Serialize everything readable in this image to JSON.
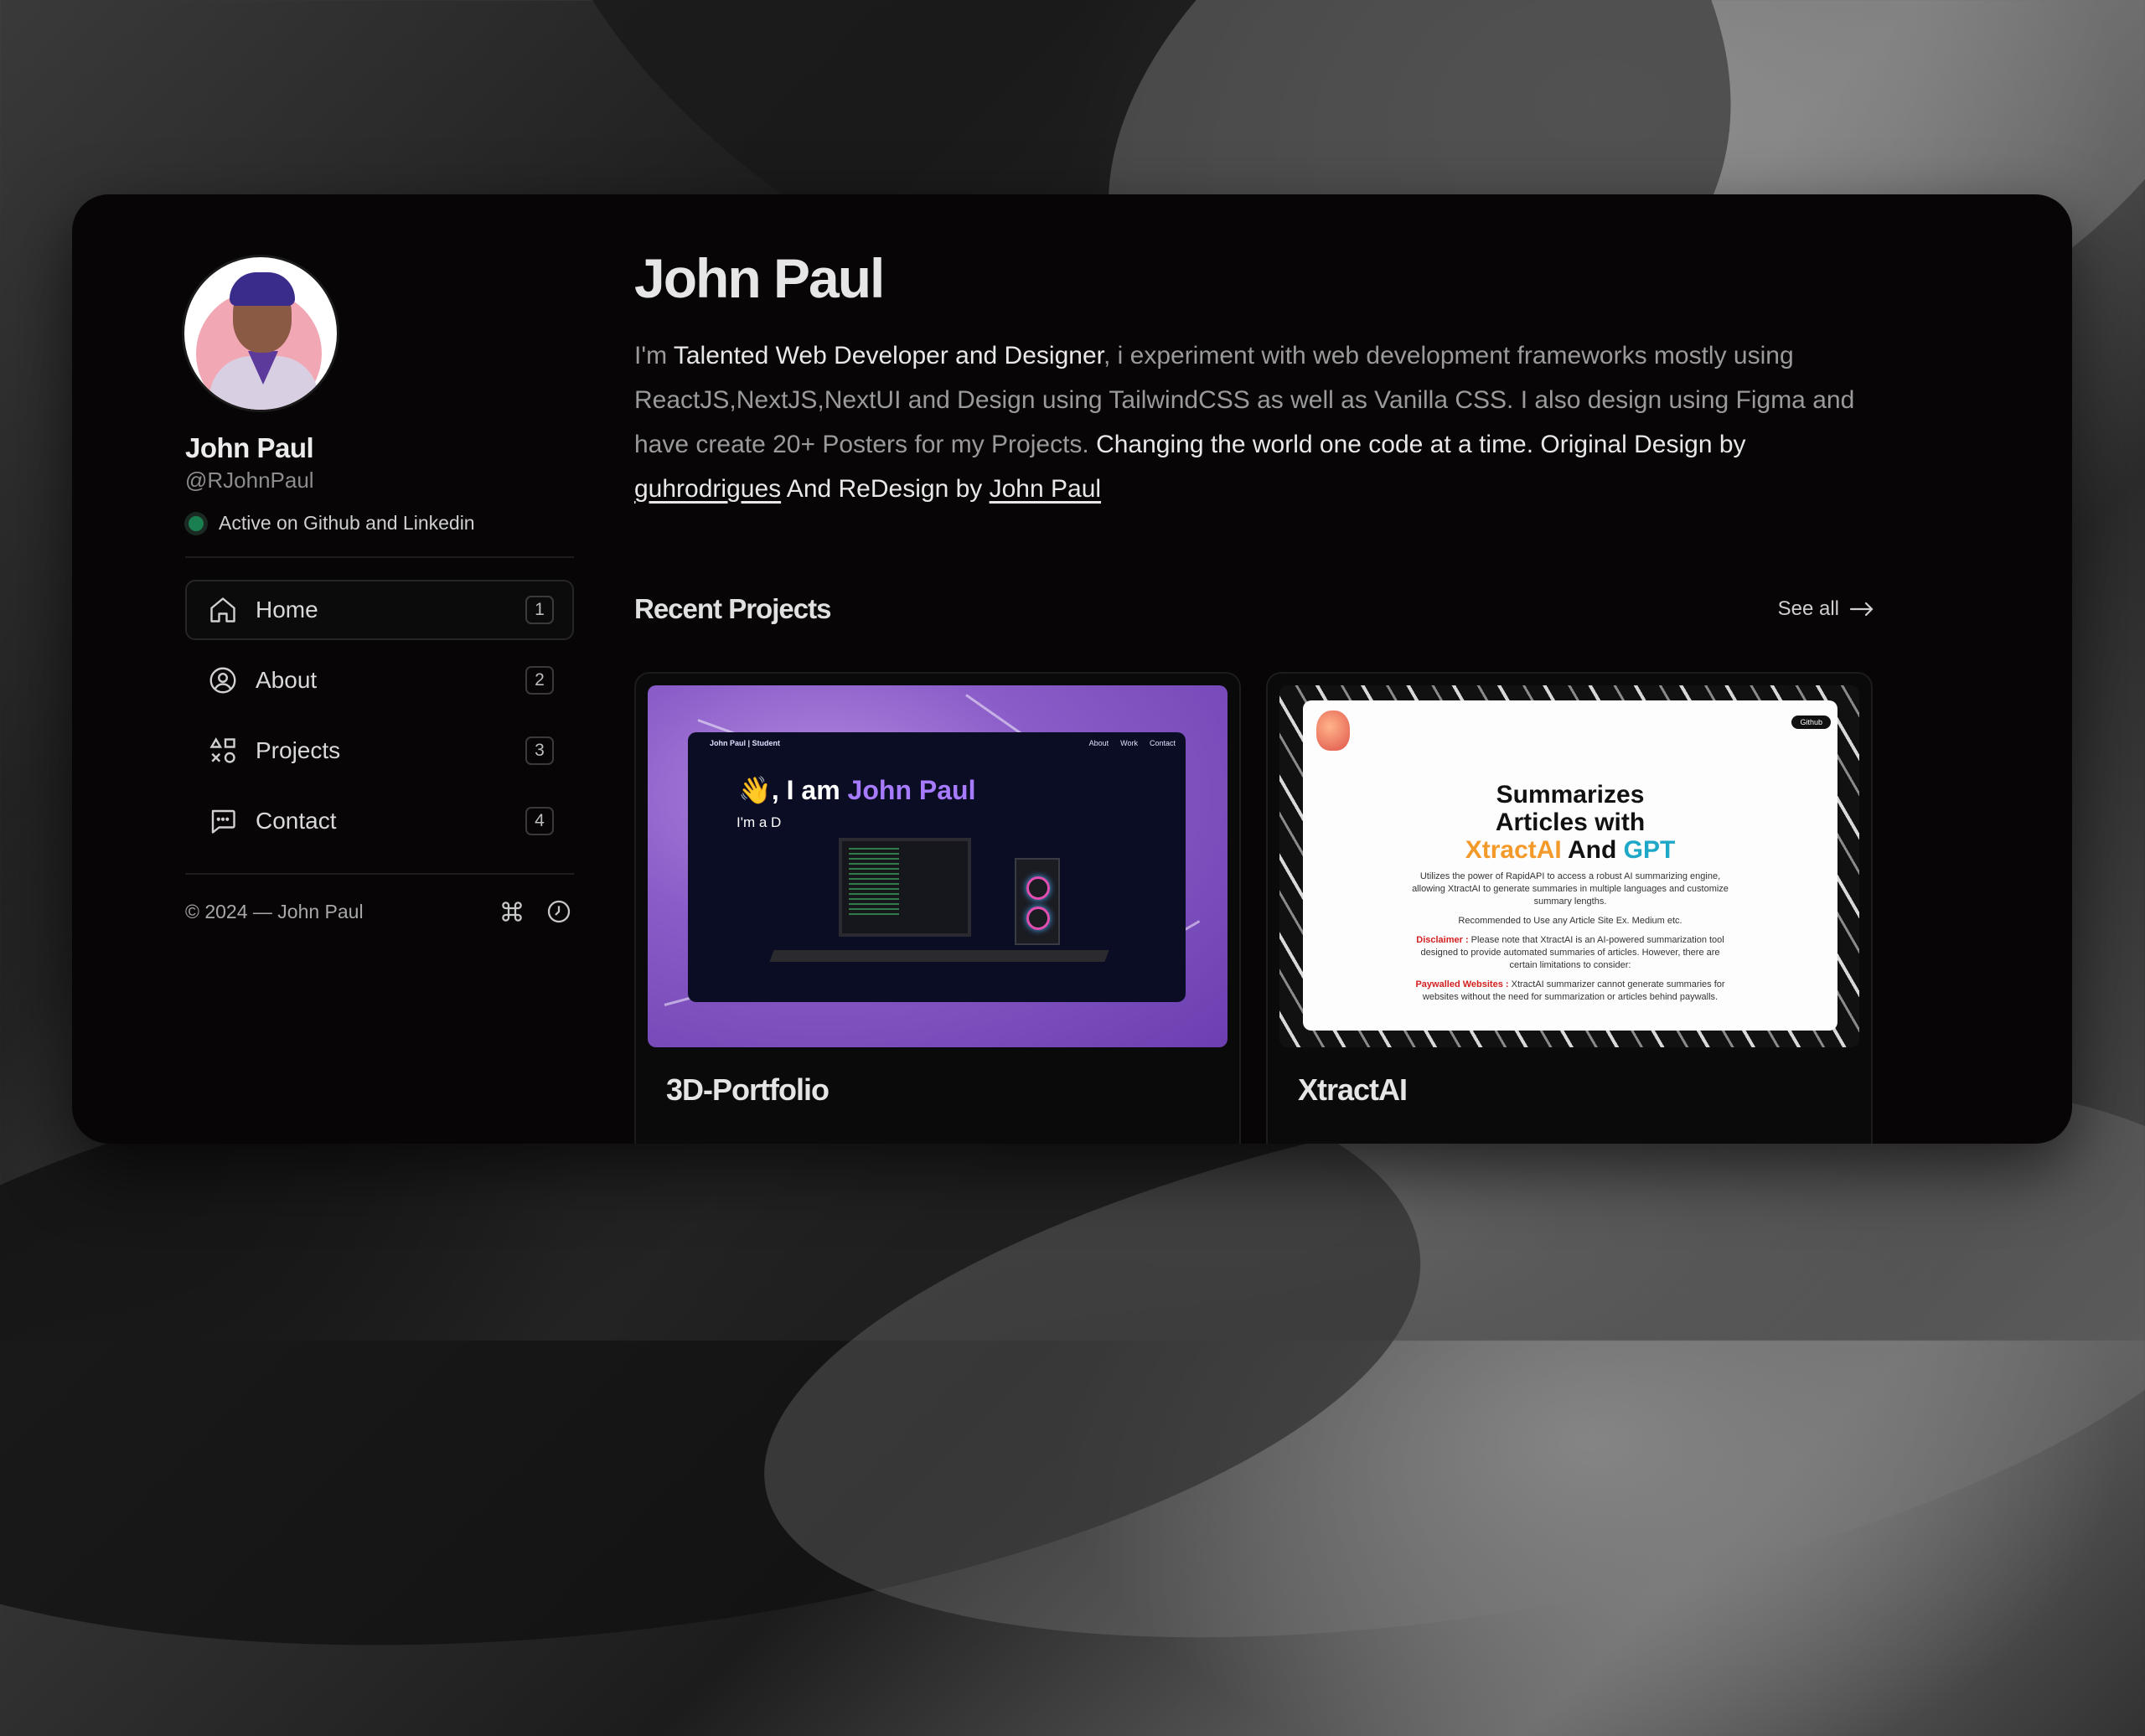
{
  "profile": {
    "name": "John Paul",
    "handle": "@RJohnPaul",
    "status": "Active on Github and Linkedin"
  },
  "nav": [
    {
      "label": "Home",
      "key": "1",
      "icon": "home-icon",
      "active": true
    },
    {
      "label": "About",
      "key": "2",
      "icon": "user-circle-icon",
      "active": false
    },
    {
      "label": "Projects",
      "key": "3",
      "icon": "shapes-icon",
      "active": false
    },
    {
      "label": "Contact",
      "key": "4",
      "icon": "chat-icon",
      "active": false
    }
  ],
  "footer": {
    "copyright": "© 2024 — John Paul",
    "icons": [
      "command-icon",
      "clock-icon"
    ]
  },
  "main": {
    "title": "John Paul",
    "bio": {
      "p1": "I'm ",
      "hl1": "Talented Web Developer and Designer",
      "p2": ", i experiment with web development frameworks mostly using ReactJS,NextJS,NextUI and Design using TailwindCSS as well as Vanilla CSS. I also design using Figma and have create 20+ Posters for my Projects. ",
      "hl2": "Changing the world one code at a time. Original Design by ",
      "link1": "guhrodrigues",
      "hl3": " And ReDesign by ",
      "link2": "John Paul"
    },
    "recent_title": "Recent Projects",
    "see_all": "See all"
  },
  "projects": [
    {
      "title": "3D-Portfolio",
      "thumb": {
        "nav_brand": "John Paul | Student",
        "nav_links": [
          "About",
          "Work",
          "Contact"
        ],
        "greeting_prefix": "👋, I am ",
        "greeting_name": "John Paul",
        "subtitle": "I'm a D"
      }
    },
    {
      "title": "XtractAI",
      "thumb": {
        "github_badge": "Github",
        "headline_1": "Summarizes",
        "headline_2": "Articles with",
        "headline_3a": "XtractAI",
        "headline_3b": " And ",
        "headline_3c": "GPT",
        "para_1": "Utilizes the power of RapidAPI to access a robust AI summarizing engine, allowing XtractAI to generate summaries in multiple languages and customize summary lengths.",
        "para_2": "Recommended to Use any Article Site Ex. Medium etc.",
        "disclaimer_label": "Disclaimer :",
        "disclaimer_text": " Please note that XtractAI is an AI-powered summarization tool designed to provide automated summaries of articles. However, there are certain limitations to consider:",
        "paywall_label": "Paywalled Websites :",
        "paywall_text": " XtractAI summarizer cannot generate summaries for websites without the need for summarization or articles behind paywalls."
      }
    }
  ],
  "colors": {
    "frame_bg": "#070506",
    "status_dot": "#1a7f50",
    "accent_purple": "#a77bff"
  }
}
